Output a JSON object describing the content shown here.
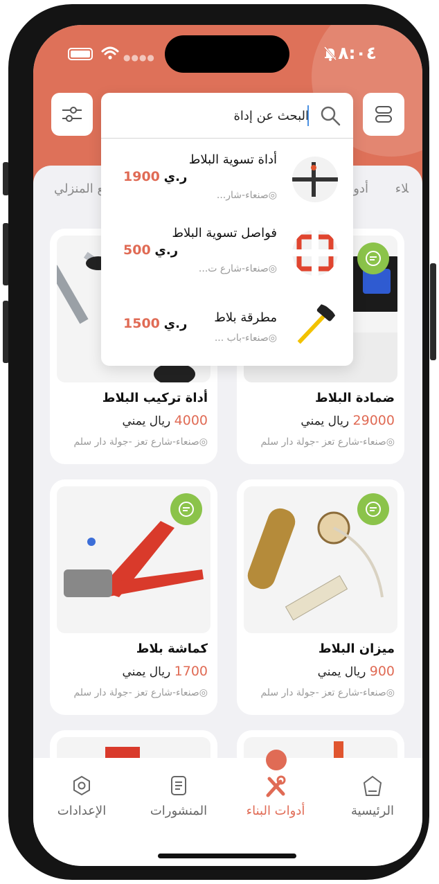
{
  "status_bar": {
    "time": "٨:٠٤"
  },
  "search": {
    "value": "البحث عن إداة",
    "placeholder": "البحث عن إداة"
  },
  "categories": [
    "ﻼء",
    "أدو",
    "بيع المنزلي"
  ],
  "results": [
    {
      "title": "أداة تسوية البلاط",
      "location": "صنعاء-شار...",
      "price": "1900",
      "currency": "ر.ي"
    },
    {
      "title": "فواصل تسوية البلاط",
      "location": "صنعاء-شارع ت...",
      "price": "500",
      "currency": "ر.ي"
    },
    {
      "title": "مطرقة بلاط",
      "location": "صنعاء-باب ...",
      "price": "1500",
      "currency": "ر.ي"
    }
  ],
  "products": [
    {
      "name": "ضمادة البلاط",
      "price": "29000",
      "currency": "ريال يمني",
      "location": "صنعاء-شارع تعز -جولة دار سلم"
    },
    {
      "name": "أداة تركيب البلاط",
      "price": "4000",
      "currency": "ريال يمني",
      "location": "صنعاء-شارع تعز -جولة دار سلم"
    },
    {
      "name": "ميزان البلاط",
      "price": "900",
      "currency": "ريال يمني",
      "location": "صنعاء-شارع تعز -جولة دار سلم"
    },
    {
      "name": "كماشة بلاط",
      "price": "1700",
      "currency": "ريال يمني",
      "location": "صنعاء-شارع تعز -جولة دار سلم"
    }
  ],
  "nav": [
    {
      "label": "الرئيسية",
      "icon": "home-icon"
    },
    {
      "label": "أدوات البناء",
      "icon": "tools-icon",
      "active": true
    },
    {
      "label": "المنشورات",
      "icon": "posts-icon"
    },
    {
      "label": "الإعدادات",
      "icon": "settings-icon"
    }
  ],
  "colors": {
    "accent": "#de7159",
    "price": "#e06b55",
    "chat": "#8bc34a"
  }
}
